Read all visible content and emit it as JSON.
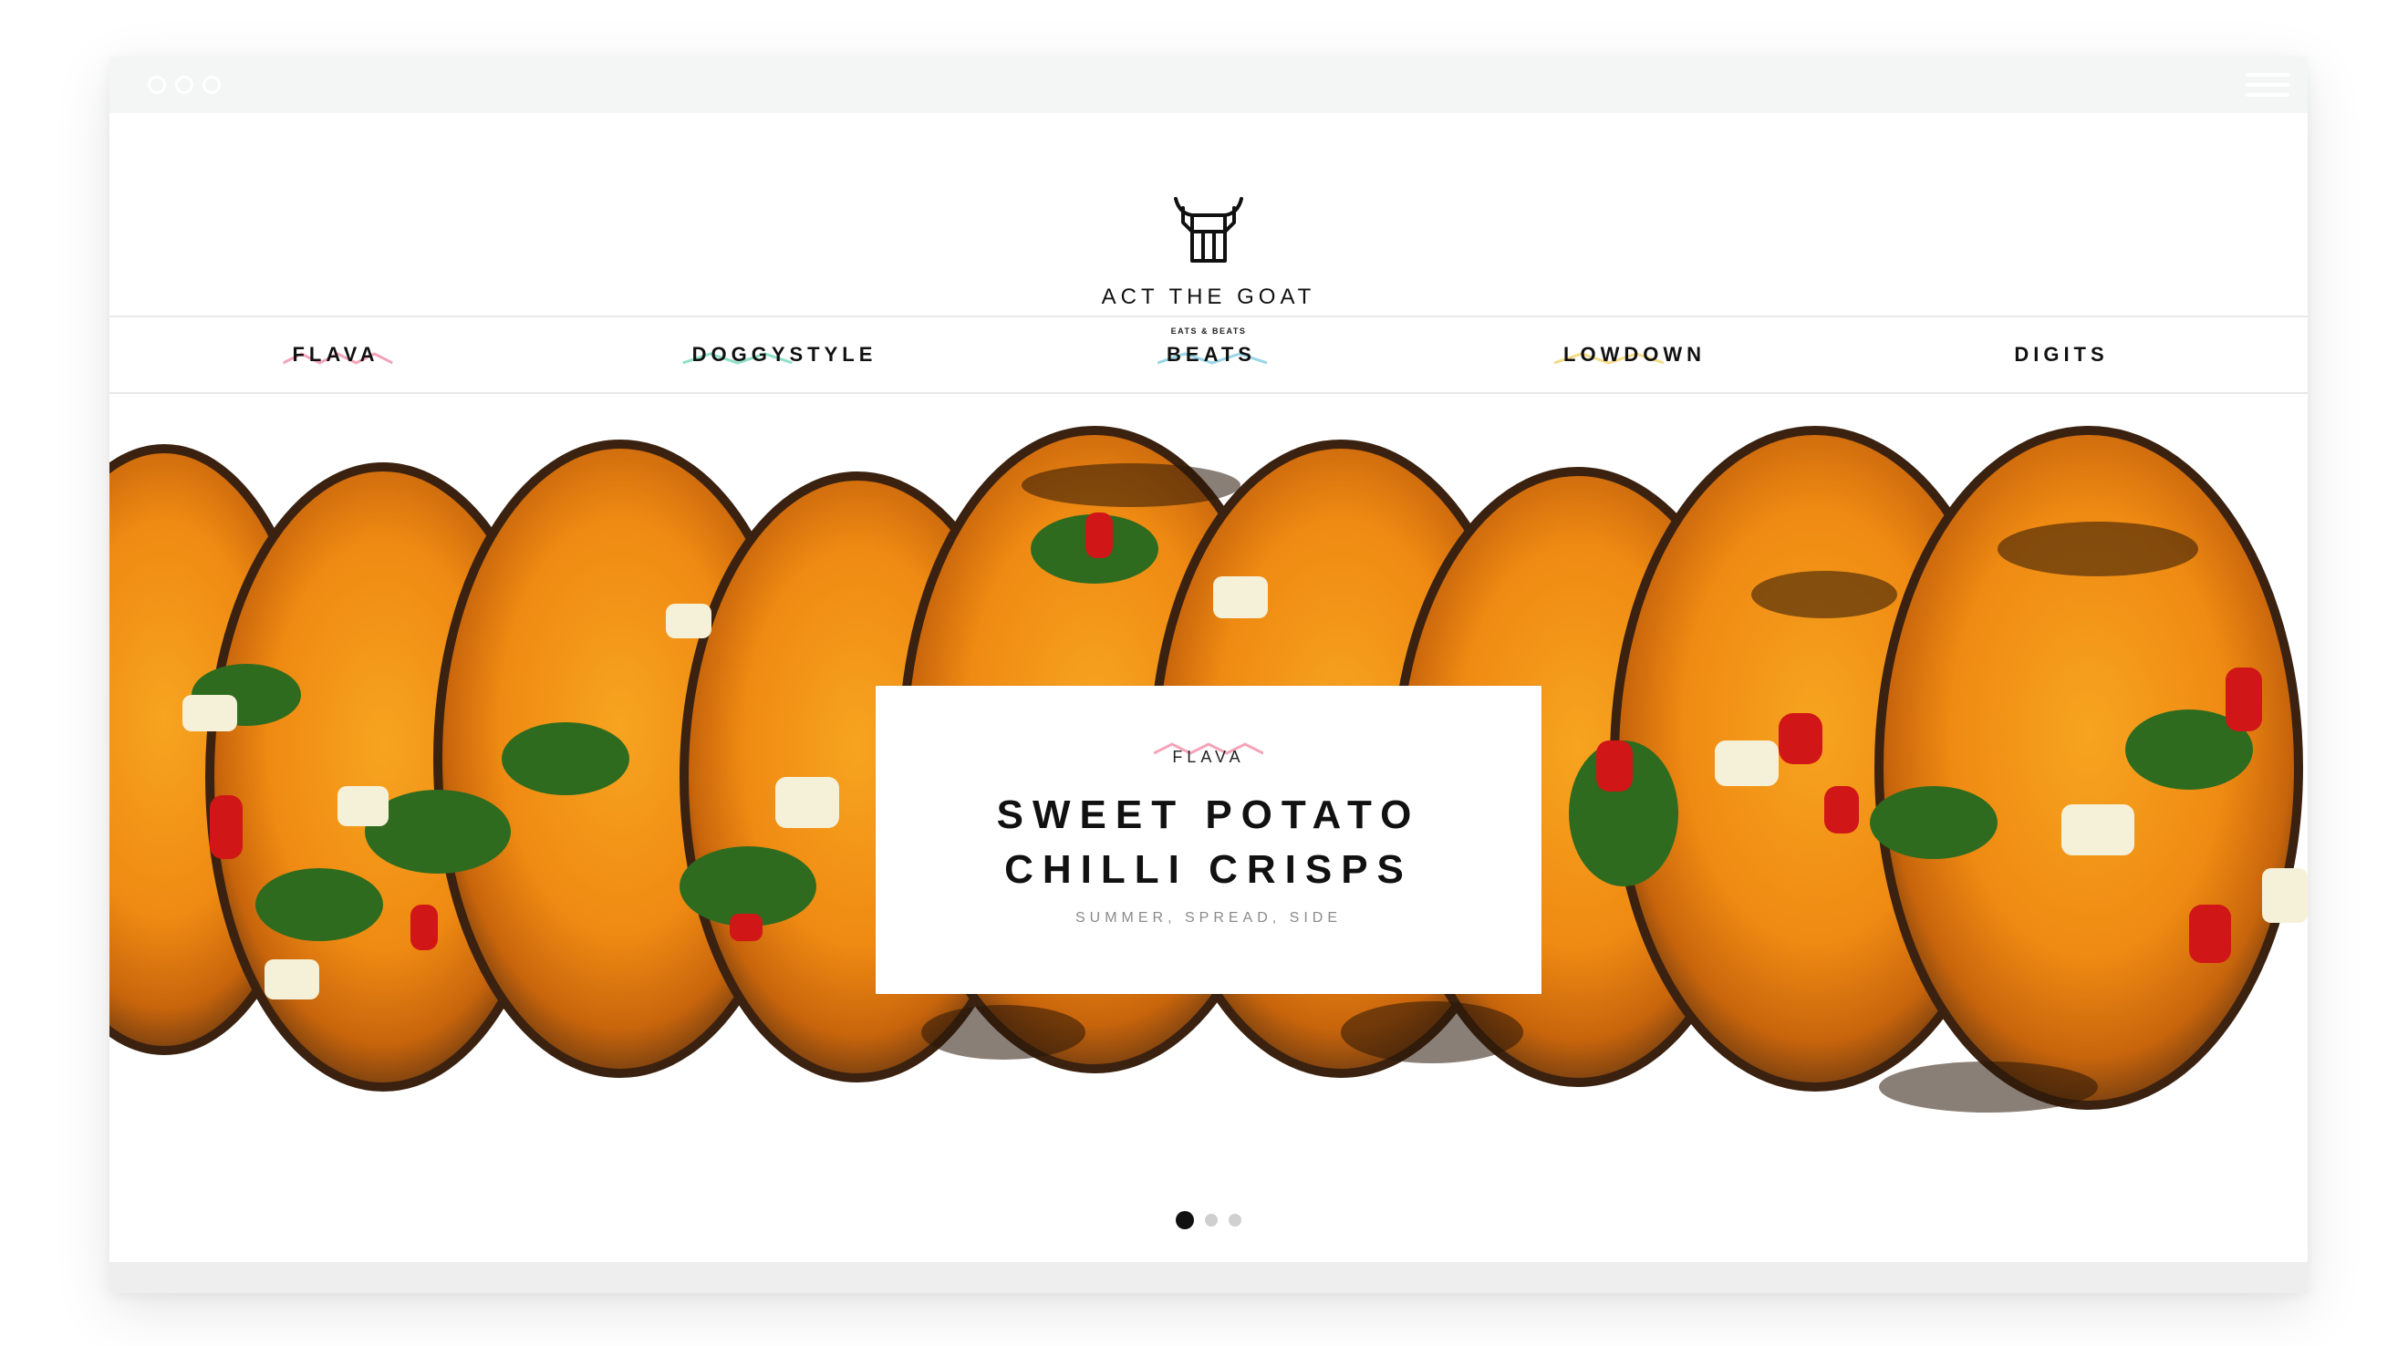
{
  "site": {
    "brand": "ACT THE GOAT",
    "tagline": "EATS & BEATS"
  },
  "nav": {
    "items": [
      {
        "label": "FLAVA",
        "accent": "#f4a3b8"
      },
      {
        "label": "DOGGYSTYLE",
        "accent": "#8fe0c8"
      },
      {
        "label": "BEATS",
        "accent": "#9ad6e6"
      },
      {
        "label": "LOWDOWN",
        "accent": "#f3dc8a"
      },
      {
        "label": "DIGITS",
        "accent": "#d8d8d8"
      }
    ]
  },
  "hero": {
    "category": "FLAVA",
    "title_line1": "SWEET POTATO",
    "title_line2": "CHILLI CRISPS",
    "tags": "SUMMER, SPREAD, SIDE",
    "image": "grilled-sweet-potato-slices-photo",
    "slides": {
      "count": 3,
      "active": 1
    }
  },
  "icons": {
    "logo": "goat-head-icon",
    "menu": "hamburger-menu-icon"
  }
}
